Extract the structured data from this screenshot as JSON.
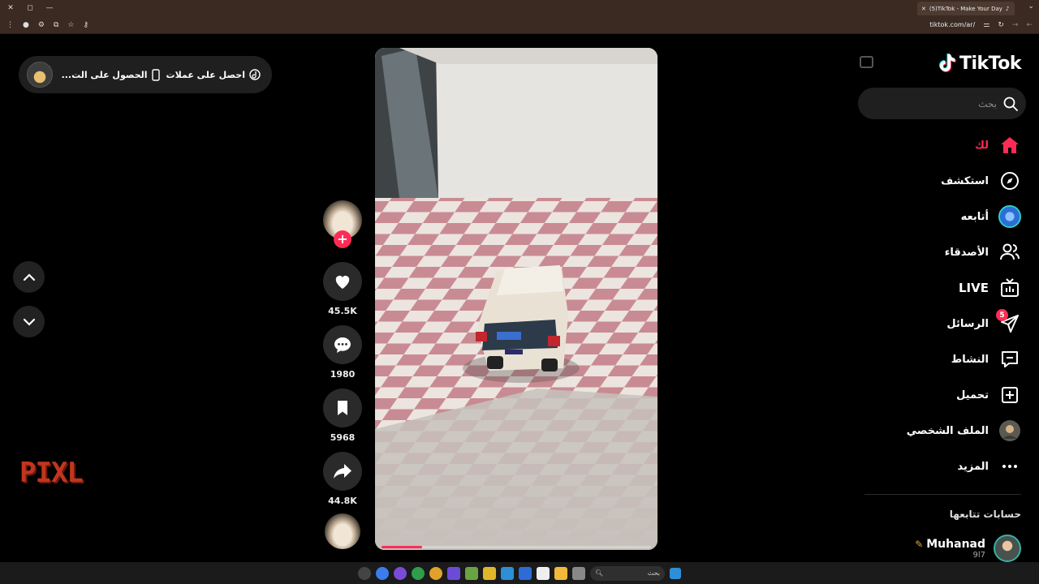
{
  "browser": {
    "tab_title": "(5)TikTok - Make Your Day",
    "url": "tiktok.com/ar/"
  },
  "coinbar": {
    "get_coins": "احصل على عملات",
    "get_app": "الحصول على الت..."
  },
  "watermark": "PIXL",
  "video": {
    "progress": 0.15
  },
  "actions": {
    "likes": "45.5K",
    "comments": "1980",
    "saves": "5968",
    "shares": "44.8K"
  },
  "sidebar": {
    "logo": "TikTok",
    "search_placeholder": "بحث",
    "items": [
      {
        "label": "لك",
        "icon": "home-icon",
        "active": true
      },
      {
        "label": "استكشف",
        "icon": "compass-icon"
      },
      {
        "label": "أتابعه",
        "icon": "following-avatar-icon"
      },
      {
        "label": "الأصدقاء",
        "icon": "friends-icon"
      },
      {
        "label": "LIVE",
        "icon": "live-tv-icon"
      },
      {
        "label": "الرسائل",
        "icon": "send-icon",
        "badge": "5"
      },
      {
        "label": "النشاط",
        "icon": "activity-icon"
      },
      {
        "label": "تحميل",
        "icon": "upload-plus-icon"
      },
      {
        "label": "الملف الشخصي",
        "icon": "profile-avatar-icon"
      },
      {
        "label": "المزيد",
        "icon": "more-dots-icon"
      }
    ],
    "following_title": "حسابات تتابعها",
    "account": {
      "name": "Muhanad",
      "sub": "9l7"
    }
  },
  "taskbar": {
    "search_label": "بحث"
  },
  "colors": {
    "accent": "#fe2c55",
    "background": "#000000"
  }
}
